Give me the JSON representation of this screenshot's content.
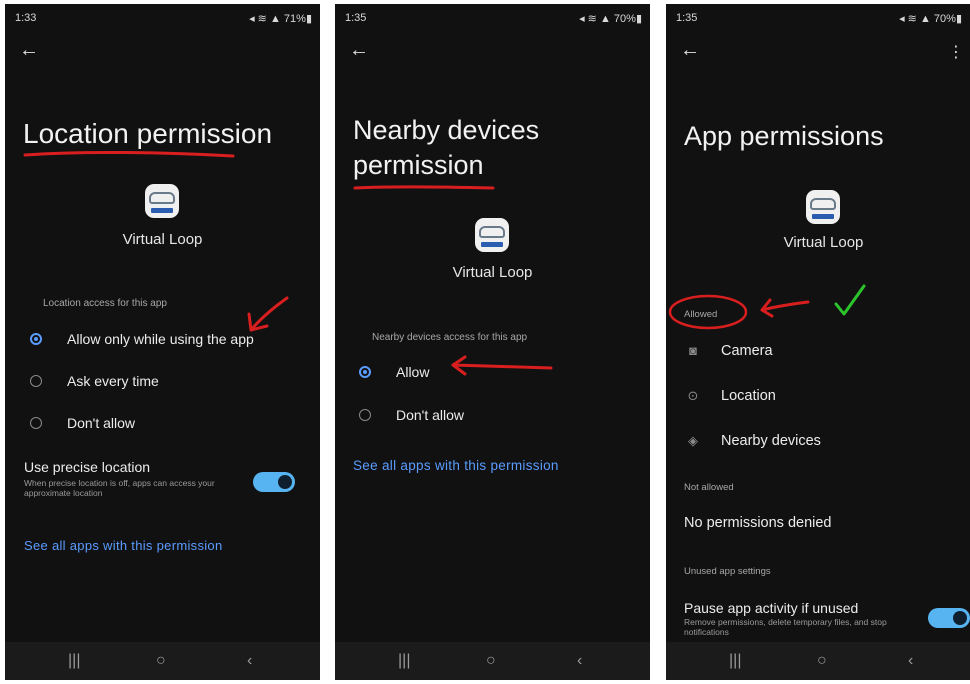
{
  "screens": [
    {
      "status": {
        "time": "1:33",
        "right": "71%"
      },
      "title": "Location permission",
      "app_name": "Virtual Loop",
      "section": "Location access for this app",
      "options": [
        {
          "label": "Allow only while using the app",
          "selected": true
        },
        {
          "label": "Ask every time",
          "selected": false
        },
        {
          "label": "Don't allow",
          "selected": false
        }
      ],
      "precise": {
        "title": "Use precise location",
        "desc": "When precise location is off, apps can access your approximate location",
        "enabled": true
      },
      "link": "See all apps with this permission"
    },
    {
      "status": {
        "time": "1:35",
        "right": "70%"
      },
      "title_line1": "Nearby devices",
      "title_line2": "permission",
      "app_name": "Virtual Loop",
      "section": "Nearby devices access for this app",
      "options": [
        {
          "label": "Allow",
          "selected": true
        },
        {
          "label": "Don't allow",
          "selected": false
        }
      ],
      "link": "See all apps with this permission"
    },
    {
      "status": {
        "time": "1:35",
        "right": "70%"
      },
      "title": "App permissions",
      "app_name": "Virtual Loop",
      "allowed_header": "Allowed",
      "allowed": [
        {
          "label": "Camera",
          "icon": "camera-icon"
        },
        {
          "label": "Location",
          "icon": "location-pin-icon"
        },
        {
          "label": "Nearby devices",
          "icon": "nearby-devices-icon"
        }
      ],
      "not_allowed_header": "Not allowed",
      "not_allowed_text": "No permissions denied",
      "unused_header": "Unused app settings",
      "pause": {
        "title": "Pause app activity if unused",
        "desc": "Remove permissions, delete temporary files, and stop notifications",
        "enabled": true
      }
    }
  ],
  "colors": {
    "accent": "#5b9cff",
    "toggle": "#58b4f0",
    "annotation_red": "#d81e1e",
    "annotation_green": "#2bc42b"
  }
}
